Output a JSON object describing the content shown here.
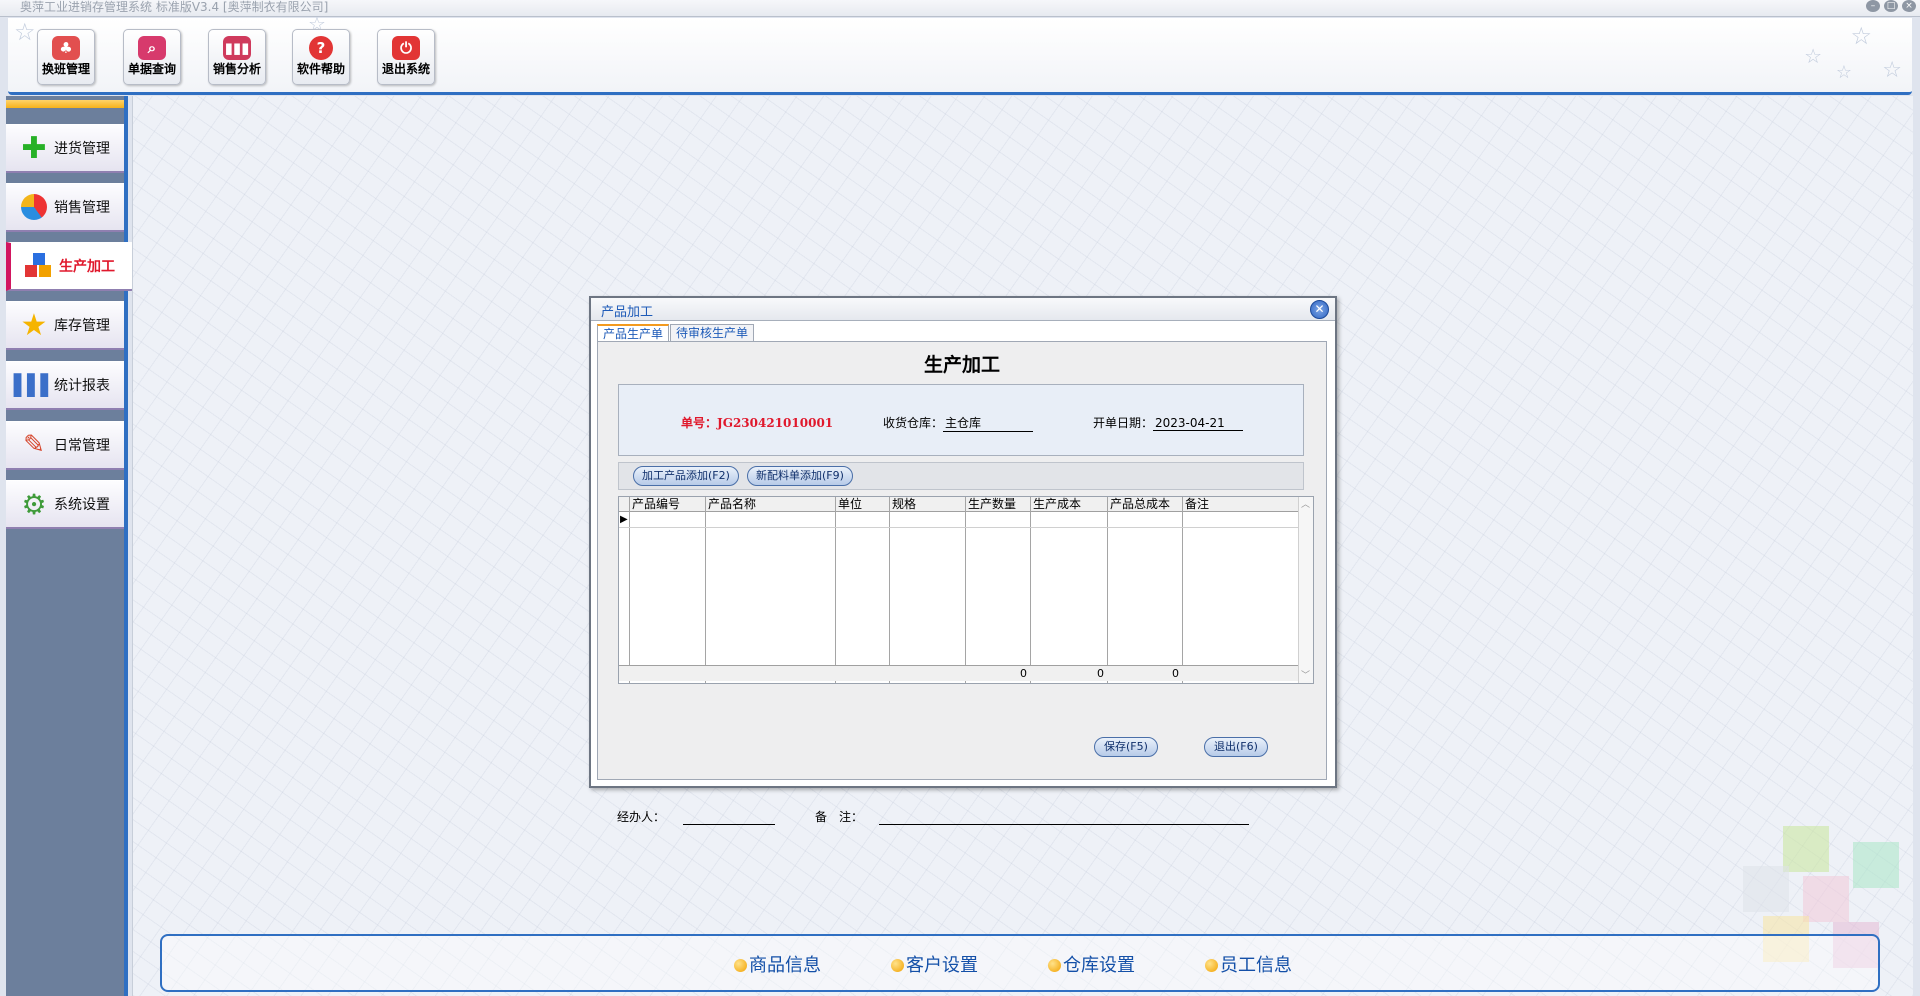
{
  "window": {
    "title": "奥萍工业进销存管理系统 标准版V3.4 [奥萍制衣有限公司]"
  },
  "toolbar": {
    "buttons": [
      {
        "label": "换班管理",
        "icon": "shift-icon"
      },
      {
        "label": "单据查询",
        "icon": "magnifier-icon"
      },
      {
        "label": "销售分析",
        "icon": "bar-chart-icon"
      },
      {
        "label": "软件帮助",
        "icon": "help-icon"
      },
      {
        "label": "退出系统",
        "icon": "power-icon"
      }
    ]
  },
  "sidebar": {
    "items": [
      {
        "label": "进货管理",
        "icon": "plus-icon"
      },
      {
        "label": "销售管理",
        "icon": "pie-icon"
      },
      {
        "label": "生产加工",
        "icon": "blocks-icon",
        "active": true
      },
      {
        "label": "库存管理",
        "icon": "star-icon"
      },
      {
        "label": "统计报表",
        "icon": "report-icon"
      },
      {
        "label": "日常管理",
        "icon": "tools-icon"
      },
      {
        "label": "系统设置",
        "icon": "gear-icon"
      }
    ]
  },
  "dialog": {
    "title": "产品加工",
    "tabs": [
      "产品生产单",
      "待审核生产单"
    ],
    "heading": "生产加工",
    "order_label": "单号：",
    "order_no": "JG230421010001",
    "warehouse_label": "收货仓库：",
    "warehouse": "主仓库",
    "date_label": "开单日期：",
    "date": "2023-04-21",
    "add_product_btn": "加工产品添加(F2)",
    "add_material_btn": "新配料单添加(F9)",
    "columns": [
      "产品编号",
      "产品名称",
      "单位",
      "规格",
      "生产数量",
      "生产成本",
      "产品总成本",
      "备注"
    ],
    "totals": {
      "qty": "0",
      "cost": "0",
      "total": "0"
    },
    "handler_label": "经办人：",
    "handler": "",
    "remark_label": "备　注：",
    "remark": "",
    "save_btn": "保存(F5)",
    "exit_btn": "退出(F6)"
  },
  "bottom_links": [
    "商品信息",
    "客户设置",
    "仓库设置",
    "员工信息"
  ],
  "colors": {
    "accent": "#2f6fc2",
    "active": "#e0182c",
    "order_no": "#e0182c"
  }
}
